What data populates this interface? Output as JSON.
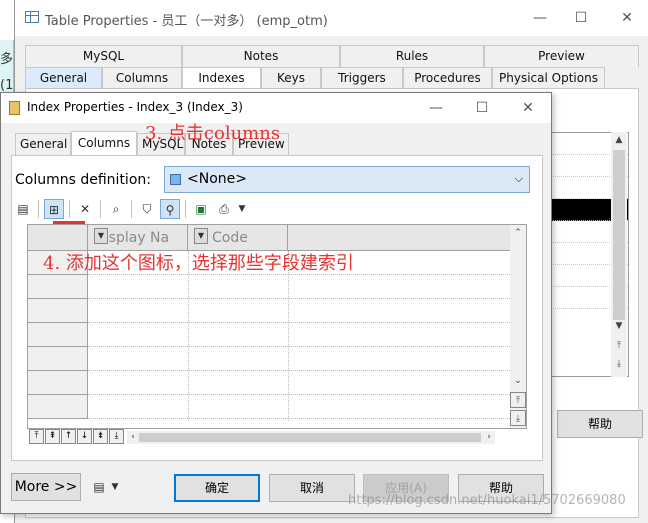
{
  "background_strip": {
    "chars": [
      "多",
      "(1",
      "(",
      "("
    ]
  },
  "back_window": {
    "title": "Table Properties - 员工（一对多） (emp_otm)",
    "controls": {
      "minimize": "—",
      "maximize": "☐",
      "close": "✕"
    },
    "tabs_row1": [
      "MySQL",
      "Notes",
      "Rules",
      "Preview"
    ],
    "tabs_row2": [
      "General",
      "Columns",
      "Indexes",
      "Keys",
      "Triggers",
      "Procedures",
      "Physical Options"
    ],
    "help_label": "帮助"
  },
  "dialog": {
    "title": "Index Properties - Index_3 (Index_3)",
    "controls": {
      "minimize": "—",
      "maximize": "☐",
      "close": "✕"
    },
    "tabs": [
      "General",
      "Columns",
      "MySQL",
      "Notes",
      "Preview"
    ],
    "active_tab": "Columns",
    "columns_definition_label": "Columns definition:",
    "columns_definition_value": "<None>",
    "grid_headers": [
      "Display Na",
      "Code"
    ],
    "buttons": {
      "more": "More >>",
      "ok": "确定",
      "cancel": "取消",
      "apply": "应用(A)",
      "help": "帮助"
    }
  },
  "annotations": {
    "step3": "3. 点击columns",
    "step4": "4. 添加这个图标，选择那些字段建索引",
    "color": "#e53333"
  },
  "watermark": "https://blog.csdn.net/huokai1/5702669080",
  "colors": {
    "accent": "#0078d7",
    "annotation": "#e53333",
    "selection": "#cde4f7"
  }
}
